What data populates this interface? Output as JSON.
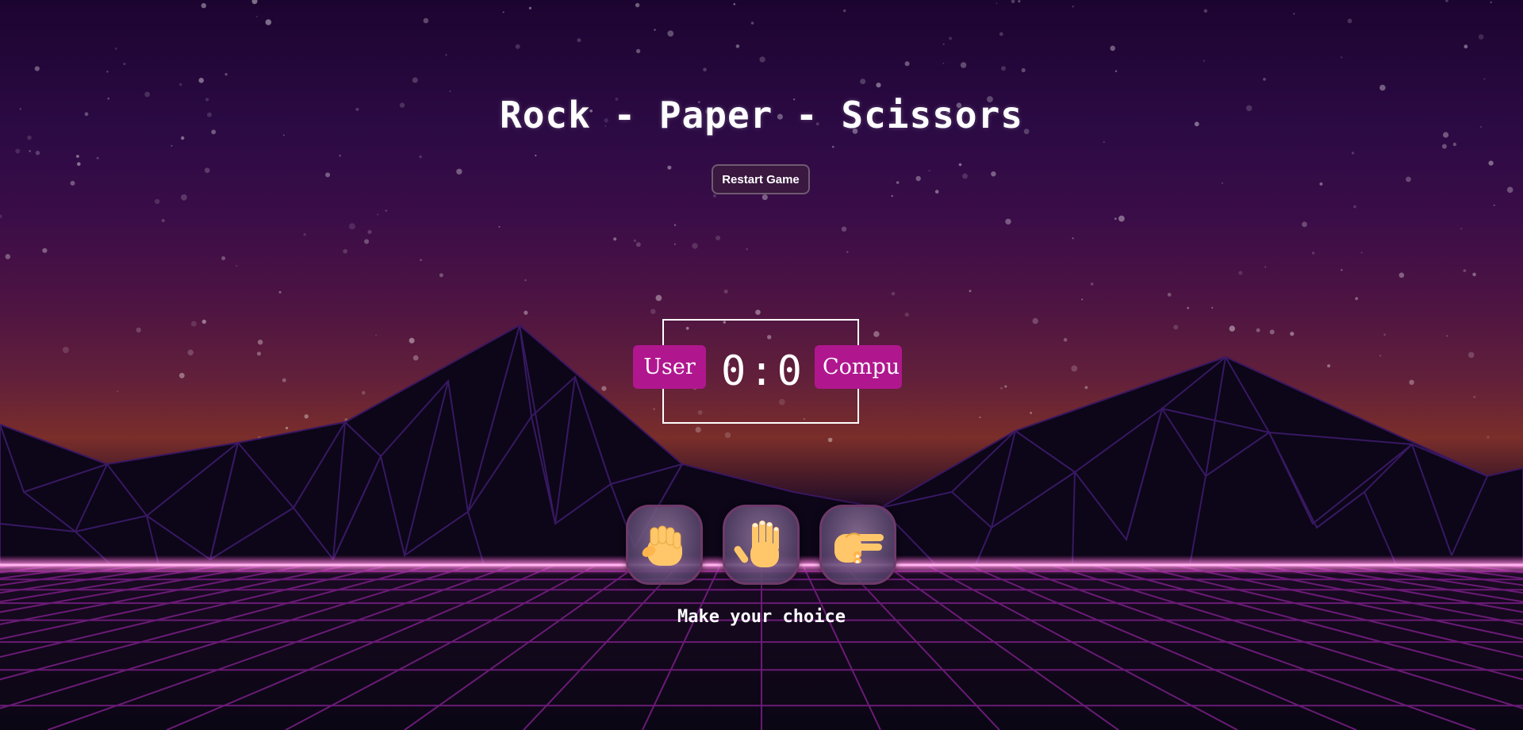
{
  "game": {
    "title": "Rock - Paper - Scissors",
    "restart_label": "Restart Game",
    "message": "Make your choice"
  },
  "scoreboard": {
    "user_label": "User",
    "computer_label": "Compu",
    "user_score": "0",
    "separator": ":",
    "computer_score": "0"
  },
  "choices": [
    {
      "name": "rock",
      "icon": "raised-fist-hand-icon"
    },
    {
      "name": "paper",
      "icon": "raised-hand-icon"
    },
    {
      "name": "scissors",
      "icon": "victory-hand-icon"
    }
  ],
  "colors": {
    "badge": "#b0178f",
    "neon_grid": "#c0268f",
    "skin": "#ffc76a"
  }
}
